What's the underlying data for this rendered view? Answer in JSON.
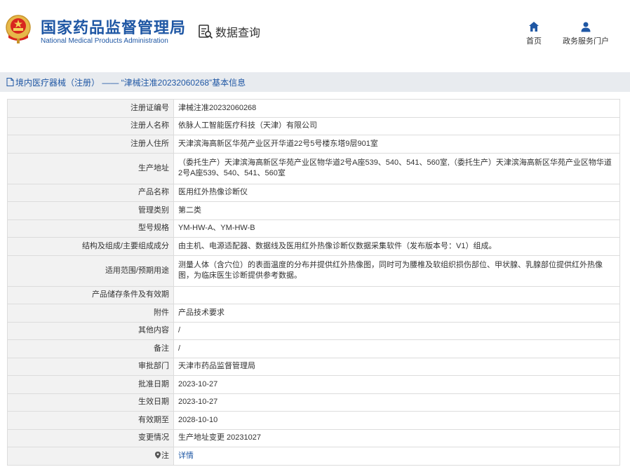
{
  "header": {
    "title_cn": "国家药品监督管理局",
    "title_en": "National Medical Products Administration",
    "query_label": "数据查询",
    "nav": {
      "home": "首页",
      "portal": "政务服务门户"
    }
  },
  "breadcrumb": {
    "text": "境内医疗器械（注册） —— “津械注准20232060268”基本信息"
  },
  "rows": [
    {
      "label": "注册证编号",
      "value": "津械注准20232060268"
    },
    {
      "label": "注册人名称",
      "value": "依脉人工智能医疗科技（天津）有限公司"
    },
    {
      "label": "注册人住所",
      "value": "天津滨海高新区华苑产业区开华道22号5号楼东塔9层901室"
    },
    {
      "label": "生产地址",
      "value": "（委托生产）天津滨海高新区华苑产业区物华道2号A座539、540、541、560室,（委托生产）天津滨海高新区华苑产业区物华道2号A座539、540、541、560室"
    },
    {
      "label": "产品名称",
      "value": "医用红外热像诊断仪"
    },
    {
      "label": "管理类别",
      "value": "第二类"
    },
    {
      "label": "型号规格",
      "value": "YM-HW-A、YM-HW-B"
    },
    {
      "label": "结构及组成/主要组成成分",
      "value": "由主机、电源适配器、数据线及医用红外热像诊断仪数据采集软件（发布版本号：V1）组成。"
    },
    {
      "label": "适用范围/预期用途",
      "value": "测量人体（含穴位）的表面温度的分布并提供红外热像图，同时可为腰椎及软组织损伤部位、甲状腺、乳腺部位提供红外热像图，为临床医生诊断提供参考数据。"
    },
    {
      "label": "产品储存条件及有效期",
      "value": ""
    },
    {
      "label": "附件",
      "value": "产品技术要求"
    },
    {
      "label": "其他内容",
      "value": "/"
    },
    {
      "label": "备注",
      "value": "/"
    },
    {
      "label": "审批部门",
      "value": "天津市药品监督管理局"
    },
    {
      "label": "批准日期",
      "value": "2023-10-27"
    },
    {
      "label": "生效日期",
      "value": "2023-10-27"
    },
    {
      "label": "有效期至",
      "value": "2028-10-10"
    },
    {
      "label": "变更情况",
      "value": "生产地址变更 20231027"
    },
    {
      "label": "注",
      "value": "详情"
    }
  ],
  "colors": {
    "brand_blue": "#1f57a4",
    "label_bg": "#f2f2f2",
    "crumb_bg": "#e8ebef",
    "border": "#dcdcdc"
  },
  "icons": [
    "national-emblem-icon",
    "data-query-icon",
    "home-icon",
    "user-icon",
    "document-icon",
    "location-pin-icon"
  ]
}
